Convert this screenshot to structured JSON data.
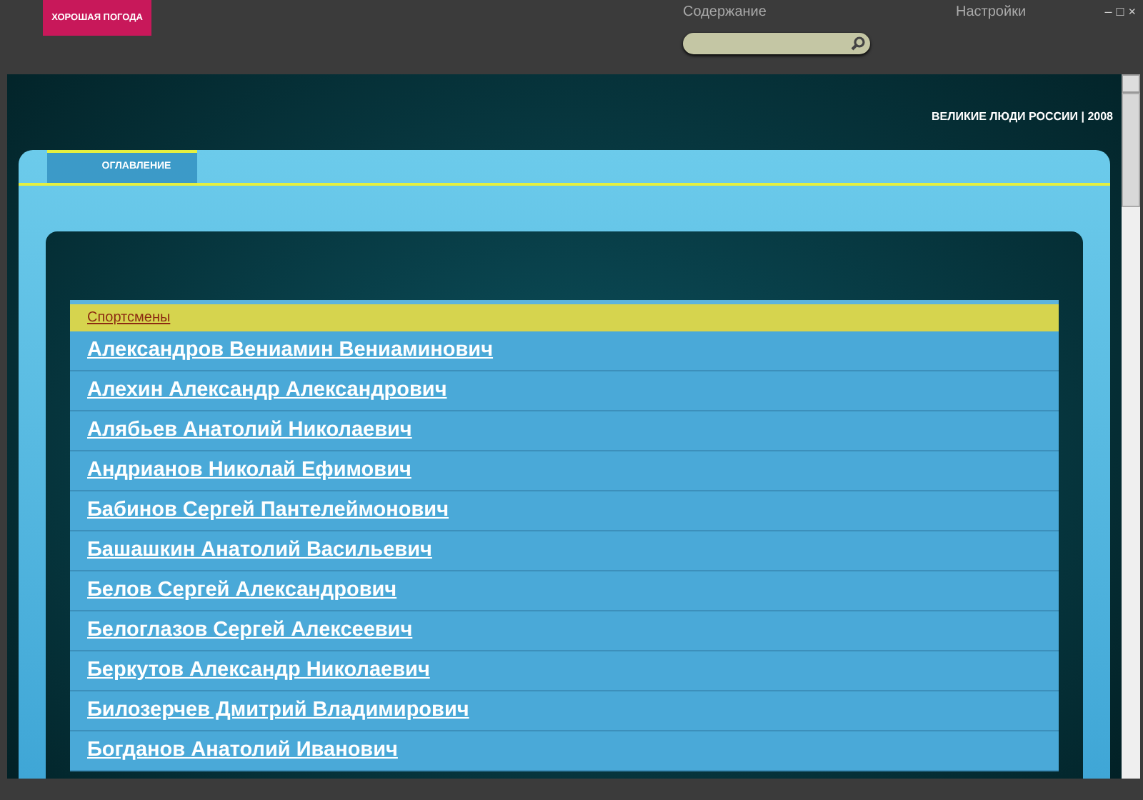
{
  "logo": "ХОРОШАЯ ПОГОДА",
  "menu": [
    "Содержание",
    "Настройки"
  ],
  "window_controls": [
    "–",
    "□",
    "×"
  ],
  "header": "ВЕЛИКИЕ ЛЮДИ РОССИИ | 2008",
  "tabs": [
    {
      "label": "ОГЛАВЛЕНИЕ",
      "selected": true
    }
  ],
  "list": {
    "title": "Спортсмены",
    "items": [
      "Александров Вениамин Вениаминович",
      "Алехин Александр Александрович",
      "Алябьев Анатолий Николаевич",
      "Андрианов Николай Ефимович",
      "Бабинов Сергей Пантелеймонович",
      "Башашкин Анатолий Васильевич",
      "Белов Сергей Александрович",
      "Белоглазов Сергей Алексеевич",
      "Беркутов Александр Николаевич",
      "Билозерчев Дмитрий Владимирович",
      "Богданов Анатолий Иванович"
    ]
  }
}
